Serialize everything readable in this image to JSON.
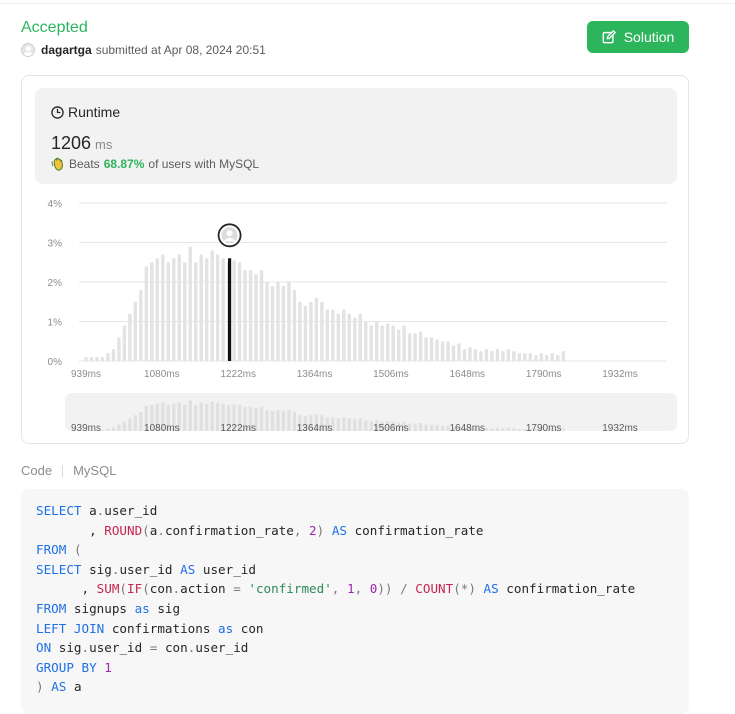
{
  "header": {
    "status": "Accepted",
    "username": "dagartga",
    "submitted_text": "submitted at Apr 08, 2024 20:51",
    "solution_button": "Solution"
  },
  "runtime": {
    "title": "Runtime",
    "value": "1206",
    "unit": "ms",
    "beats_prefix": "Beats",
    "beats_pct": "68.87%",
    "beats_suffix": "of users with MySQL"
  },
  "chart_data": {
    "type": "bar",
    "y_tick_labels": [
      "0%",
      "1%",
      "2%",
      "3%",
      "4%"
    ],
    "ylim": [
      0,
      4
    ],
    "x_tick_labels": [
      "939ms",
      "1080ms",
      "1222ms",
      "1364ms",
      "1506ms",
      "1648ms",
      "1790ms",
      "1932ms"
    ],
    "x_ticks": [
      939,
      1080,
      1222,
      1364,
      1506,
      1648,
      1790,
      1932
    ],
    "bin_width_ms": 10.2,
    "values": [
      0.1,
      0.1,
      0.1,
      0.1,
      0.2,
      0.3,
      0.6,
      0.9,
      1.2,
      1.5,
      1.8,
      2.4,
      2.5,
      2.6,
      2.7,
      2.5,
      2.6,
      2.7,
      2.5,
      2.9,
      2.5,
      2.7,
      2.6,
      2.8,
      2.7,
      2.6,
      2.5,
      2.55,
      2.5,
      2.3,
      2.3,
      2.2,
      2.3,
      2.0,
      1.9,
      2.0,
      1.9,
      2.0,
      1.8,
      1.5,
      1.4,
      1.5,
      1.6,
      1.5,
      1.3,
      1.3,
      1.2,
      1.3,
      1.2,
      1.1,
      1.2,
      1.0,
      0.9,
      1.0,
      0.9,
      0.95,
      0.9,
      0.8,
      0.9,
      0.7,
      0.7,
      0.75,
      0.6,
      0.6,
      0.55,
      0.5,
      0.5,
      0.4,
      0.45,
      0.3,
      0.35,
      0.3,
      0.25,
      0.3,
      0.25,
      0.3,
      0.25,
      0.3,
      0.25,
      0.2,
      0.2,
      0.2,
      0.15,
      0.2,
      0.15,
      0.2,
      0.15,
      0.25
    ],
    "highlight": {
      "x_ms": 1206,
      "value": 2.6
    }
  },
  "code": {
    "tab_label": "Code",
    "language": "MySQL",
    "lines": [
      [
        [
          "kw",
          "SELECT"
        ],
        [
          "t",
          " a"
        ],
        [
          "op",
          "."
        ],
        [
          "t",
          "user_id"
        ]
      ],
      [
        [
          "t",
          "       , "
        ],
        [
          "fn",
          "ROUND"
        ],
        [
          "op",
          "("
        ],
        [
          "t",
          "a"
        ],
        [
          "op",
          "."
        ],
        [
          "t",
          "confirmation_rate"
        ],
        [
          "op",
          ", "
        ],
        [
          "num",
          "2"
        ],
        [
          "op",
          ")"
        ],
        [
          "t",
          " "
        ],
        [
          "kw",
          "AS"
        ],
        [
          "t",
          " confirmation_rate"
        ]
      ],
      [
        [
          "kw",
          "FROM"
        ],
        [
          "t",
          " "
        ],
        [
          "op",
          "("
        ]
      ],
      [
        [
          "kw",
          "SELECT"
        ],
        [
          "t",
          " sig"
        ],
        [
          "op",
          "."
        ],
        [
          "t",
          "user_id "
        ],
        [
          "kw",
          "AS"
        ],
        [
          "t",
          " user_id"
        ]
      ],
      [
        [
          "t",
          "      , "
        ],
        [
          "fn",
          "SUM"
        ],
        [
          "op",
          "("
        ],
        [
          "fn",
          "IF"
        ],
        [
          "op",
          "("
        ],
        [
          "t",
          "con"
        ],
        [
          "op",
          "."
        ],
        [
          "t",
          "action "
        ],
        [
          "op",
          "="
        ],
        [
          "t",
          " "
        ],
        [
          "str",
          "'confirmed'"
        ],
        [
          "op",
          ", "
        ],
        [
          "num",
          "1"
        ],
        [
          "op",
          ", "
        ],
        [
          "num",
          "0"
        ],
        [
          "op",
          "))"
        ],
        [
          "t",
          " "
        ],
        [
          "op",
          "/"
        ],
        [
          "t",
          " "
        ],
        [
          "fn",
          "COUNT"
        ],
        [
          "op",
          "(*)"
        ],
        [
          "t",
          " "
        ],
        [
          "kw",
          "AS"
        ],
        [
          "t",
          " confirmation_rate"
        ]
      ],
      [
        [
          "kw",
          "FROM"
        ],
        [
          "t",
          " signups "
        ],
        [
          "kw",
          "as"
        ],
        [
          "t",
          " sig"
        ]
      ],
      [
        [
          "kw",
          "LEFT JOIN"
        ],
        [
          "t",
          " confirmations "
        ],
        [
          "kw",
          "as"
        ],
        [
          "t",
          " con"
        ]
      ],
      [
        [
          "kw",
          "ON"
        ],
        [
          "t",
          " sig"
        ],
        [
          "op",
          "."
        ],
        [
          "t",
          "user_id "
        ],
        [
          "op",
          "="
        ],
        [
          "t",
          " con"
        ],
        [
          "op",
          "."
        ],
        [
          "t",
          "user_id"
        ]
      ],
      [
        [
          "kw",
          "GROUP BY"
        ],
        [
          "t",
          " "
        ],
        [
          "num",
          "1"
        ]
      ],
      [
        [
          "op",
          ")"
        ],
        [
          "t",
          " "
        ],
        [
          "kw",
          "AS"
        ],
        [
          "t",
          " a"
        ]
      ]
    ]
  }
}
